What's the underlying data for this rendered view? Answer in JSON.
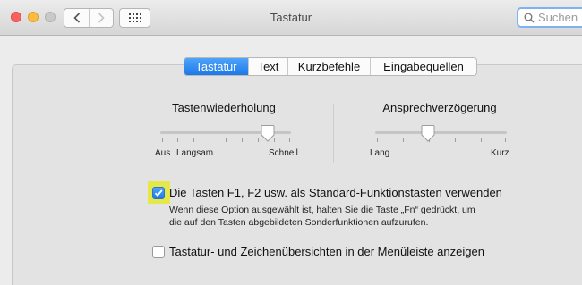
{
  "window": {
    "title": "Tastatur"
  },
  "toolbar": {
    "back_icon": "chevron-left-icon",
    "forward_icon": "chevron-right-icon",
    "grid_icon": "show-all-grid-icon",
    "search_placeholder": "Suchen"
  },
  "tabs": [
    {
      "label": "Tastatur",
      "active": true
    },
    {
      "label": "Text",
      "active": false
    },
    {
      "label": "Kurzbefehle",
      "active": false
    },
    {
      "label": "Eingabequellen",
      "active": false
    }
  ],
  "key_repeat": {
    "title": "Tastenwiederholung",
    "label_off": "Aus",
    "label_slow": "Langsam",
    "label_fast": "Schnell",
    "value_fraction": 0.82
  },
  "delay_until_repeat": {
    "title": "Ansprechverzögerung",
    "label_long": "Lang",
    "label_short": "Kurz",
    "value_fraction": 0.4
  },
  "fn_keys_option": {
    "checked": true,
    "label": "Die Tasten F1, F2 usw. als Standard-Funktionstasten verwenden",
    "description_line1": "Wenn diese Option ausgewählt ist, halten Sie die Taste „Fn“ gedrückt, um",
    "description_line2": "die auf den Tasten abgebildeten Sonderfunktionen aufzurufen."
  },
  "viewer_option": {
    "checked": false,
    "label": "Tastatur- und Zeichenübersichten in der Menüleiste anzeigen"
  },
  "colors": {
    "accent": "#1d79e8",
    "highlight": "#e6e84a",
    "close": "#fc615d",
    "minimize": "#fdbc40"
  }
}
